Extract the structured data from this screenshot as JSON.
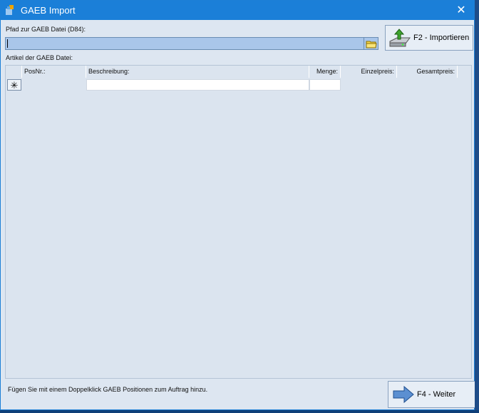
{
  "window": {
    "title": "GAEB Import",
    "close_glyph": "✕",
    "icon": "app-logo-icon"
  },
  "path": {
    "label": "Pfad zur GAEB Datei (D84):",
    "value": "",
    "placeholder": "",
    "browse_icon": "folder-icon"
  },
  "import_button": {
    "label": "F2 - Importieren",
    "icon": "disk-import-icon"
  },
  "articles": {
    "label": "Artikel der GAEB Datei:",
    "columns": [
      "PosNr.:",
      "Beschreibung:",
      "Menge:",
      "Einzelpreis:",
      "Gesamtpreis:"
    ],
    "new_row_marker": "✳"
  },
  "hint": "Fügen Sie mit einem Doppelklick GAEB Positionen zum Auftrag hinzu.",
  "next_button": {
    "label": "F4 - Weiter",
    "icon": "arrow-right-icon"
  },
  "colors": {
    "titlebar": "#1b7fd8",
    "window_bg": "#dde6f1",
    "input_bg": "#a9c6ea"
  }
}
